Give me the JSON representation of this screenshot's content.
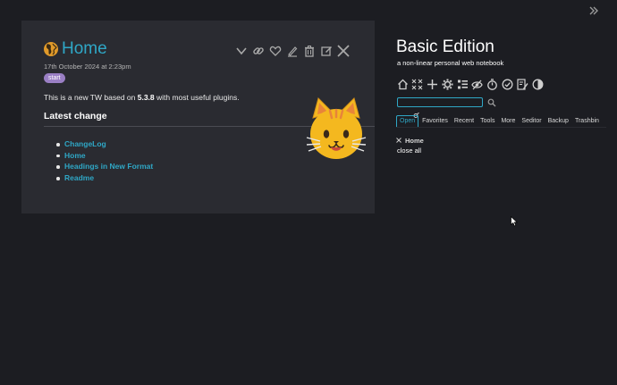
{
  "tiddler": {
    "title": "Home",
    "date": "17th October 2024 at 2:23pm",
    "tag": "start",
    "body_prefix": "This is a new TW based on ",
    "body_version": "5.3.8",
    "body_suffix": " with most useful plugins.",
    "heading": "Latest change",
    "links": [
      "ChangeLog",
      "Home",
      "Headings in New Format",
      "Readme"
    ],
    "controls": [
      "chevron-down-icon",
      "link-icon",
      "heart-icon",
      "pen-icon",
      "trash-icon",
      "edit-icon",
      "close-icon"
    ]
  },
  "sidebar": {
    "title": "Basic Edition",
    "subtitle": "a non-linear personal web notebook",
    "toolbar_icons": [
      "home-icon",
      "close-all-icon",
      "new-tiddler-icon",
      "settings-icon",
      "list-icon",
      "visibility-icon",
      "timer-icon",
      "check-icon",
      "edit-list-icon",
      "contrast-icon"
    ],
    "search": {
      "value": "",
      "placeholder": ""
    },
    "tabs": [
      "Open",
      "Favorites",
      "Recent",
      "Tools",
      "More",
      "Seditor",
      "Backup",
      "Trashbin"
    ],
    "active_tab": "Open",
    "open_items": [
      "Home"
    ],
    "close_all": "close all"
  },
  "colors": {
    "background": "#1c1d22",
    "card": "#2a2b31",
    "accent": "#2fa7c6",
    "tag": "#9a7fc4"
  }
}
